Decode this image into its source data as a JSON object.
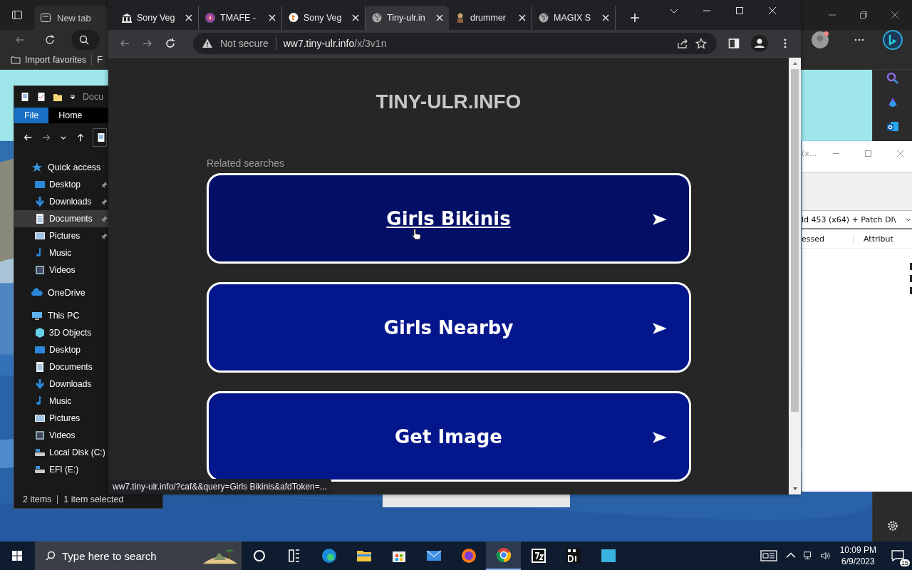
{
  "edge": {
    "tab": "New tab",
    "favorites": [
      "Import favorites",
      "F"
    ]
  },
  "explorer": {
    "title": "Docu",
    "ribbon_tabs": [
      {
        "label": "File",
        "selected": true
      },
      {
        "label": "Home",
        "selected": false
      }
    ],
    "nav": [
      {
        "label": "Quick access",
        "kind": "star",
        "selected": false,
        "children": [
          {
            "label": "Desktop",
            "kind": "desktop",
            "selected": false,
            "pinned": true
          },
          {
            "label": "Downloads",
            "kind": "downloads",
            "selected": false,
            "pinned": true
          },
          {
            "label": "Documents",
            "kind": "documents",
            "selected": true,
            "pinned": true
          },
          {
            "label": "Pictures",
            "kind": "pictures",
            "selected": false,
            "pinned": true
          },
          {
            "label": "Music",
            "kind": "music",
            "selected": false,
            "pinned": false
          },
          {
            "label": "Videos",
            "kind": "videos",
            "selected": false,
            "pinned": false
          }
        ]
      },
      {
        "label": "OneDrive",
        "kind": "cloud",
        "selected": false
      },
      {
        "label": "This PC",
        "kind": "pc",
        "selected": false,
        "children": [
          {
            "label": "3D Objects",
            "kind": "cube",
            "selected": false,
            "pinned": false
          },
          {
            "label": "Desktop",
            "kind": "desktop",
            "selected": false,
            "pinned": false
          },
          {
            "label": "Documents",
            "kind": "documents",
            "selected": false,
            "pinned": false
          },
          {
            "label": "Downloads",
            "kind": "downloads",
            "selected": false,
            "pinned": false
          },
          {
            "label": "Music",
            "kind": "music",
            "selected": false,
            "pinned": false
          },
          {
            "label": "Pictures",
            "kind": "pictures",
            "selected": false,
            "pinned": false
          },
          {
            "label": "Videos",
            "kind": "videos",
            "selected": false,
            "pinned": false
          },
          {
            "label": "Local Disk (C:)",
            "kind": "disk",
            "selected": false,
            "pinned": false
          },
          {
            "label": "EFI (E:)",
            "kind": "disk",
            "selected": false,
            "pinned": false
          }
        ]
      }
    ],
    "status": [
      "2 items",
      "1 item selected"
    ]
  },
  "chrome": {
    "tabs": [
      {
        "title": "Sony Veg",
        "kind": "bank",
        "selected": false
      },
      {
        "title": "TMAFE -",
        "kind": "badge",
        "selected": false
      },
      {
        "title": "Sony Veg",
        "kind": "letter",
        "selected": false
      },
      {
        "title": "Tiny-ulr.in",
        "kind": "globe",
        "selected": true
      },
      {
        "title": "drummer",
        "kind": "figure",
        "selected": false
      },
      {
        "title": "MAGIX S",
        "kind": "globe",
        "selected": false
      }
    ],
    "security": "Not secure",
    "url_host": "ww7.tiny-ulr.info",
    "url_path": "/x/3v1n",
    "page": {
      "heading": "TINY-ULR.INFO",
      "related_label": "Related searches",
      "links": [
        {
          "label": "Girls Bikinis",
          "hovered": true
        },
        {
          "label": "Girls Nearby",
          "hovered": false
        },
        {
          "label": "Get Image",
          "hovered": false
        }
      ]
    },
    "status_url": "ww7.tiny-ulr.info/?caf&&query=Girls Bikinis&afdToken=..."
  },
  "side_window": {
    "title": "(x...",
    "path": "ld 453 (x64) + Patch DI\\",
    "columns": [
      "essed",
      "Attribut"
    ]
  },
  "taskbar": {
    "search_placeholder": "Type here to search",
    "apps": [
      {
        "kind": "circle",
        "active": false
      },
      {
        "kind": "taskview",
        "active": false
      },
      {
        "kind": "edge",
        "active": false
      },
      {
        "kind": "folder",
        "active": false
      },
      {
        "kind": "store",
        "active": false
      },
      {
        "kind": "mail",
        "active": false
      },
      {
        "kind": "firefox",
        "active": false
      },
      {
        "kind": "chrome",
        "active": true
      },
      {
        "kind": "sevenzip",
        "active": false
      },
      {
        "kind": "di",
        "active": false
      },
      {
        "kind": "square",
        "active": false
      }
    ],
    "time": "10:09 PM",
    "date": "6/9/2023",
    "notifications": "15"
  }
}
